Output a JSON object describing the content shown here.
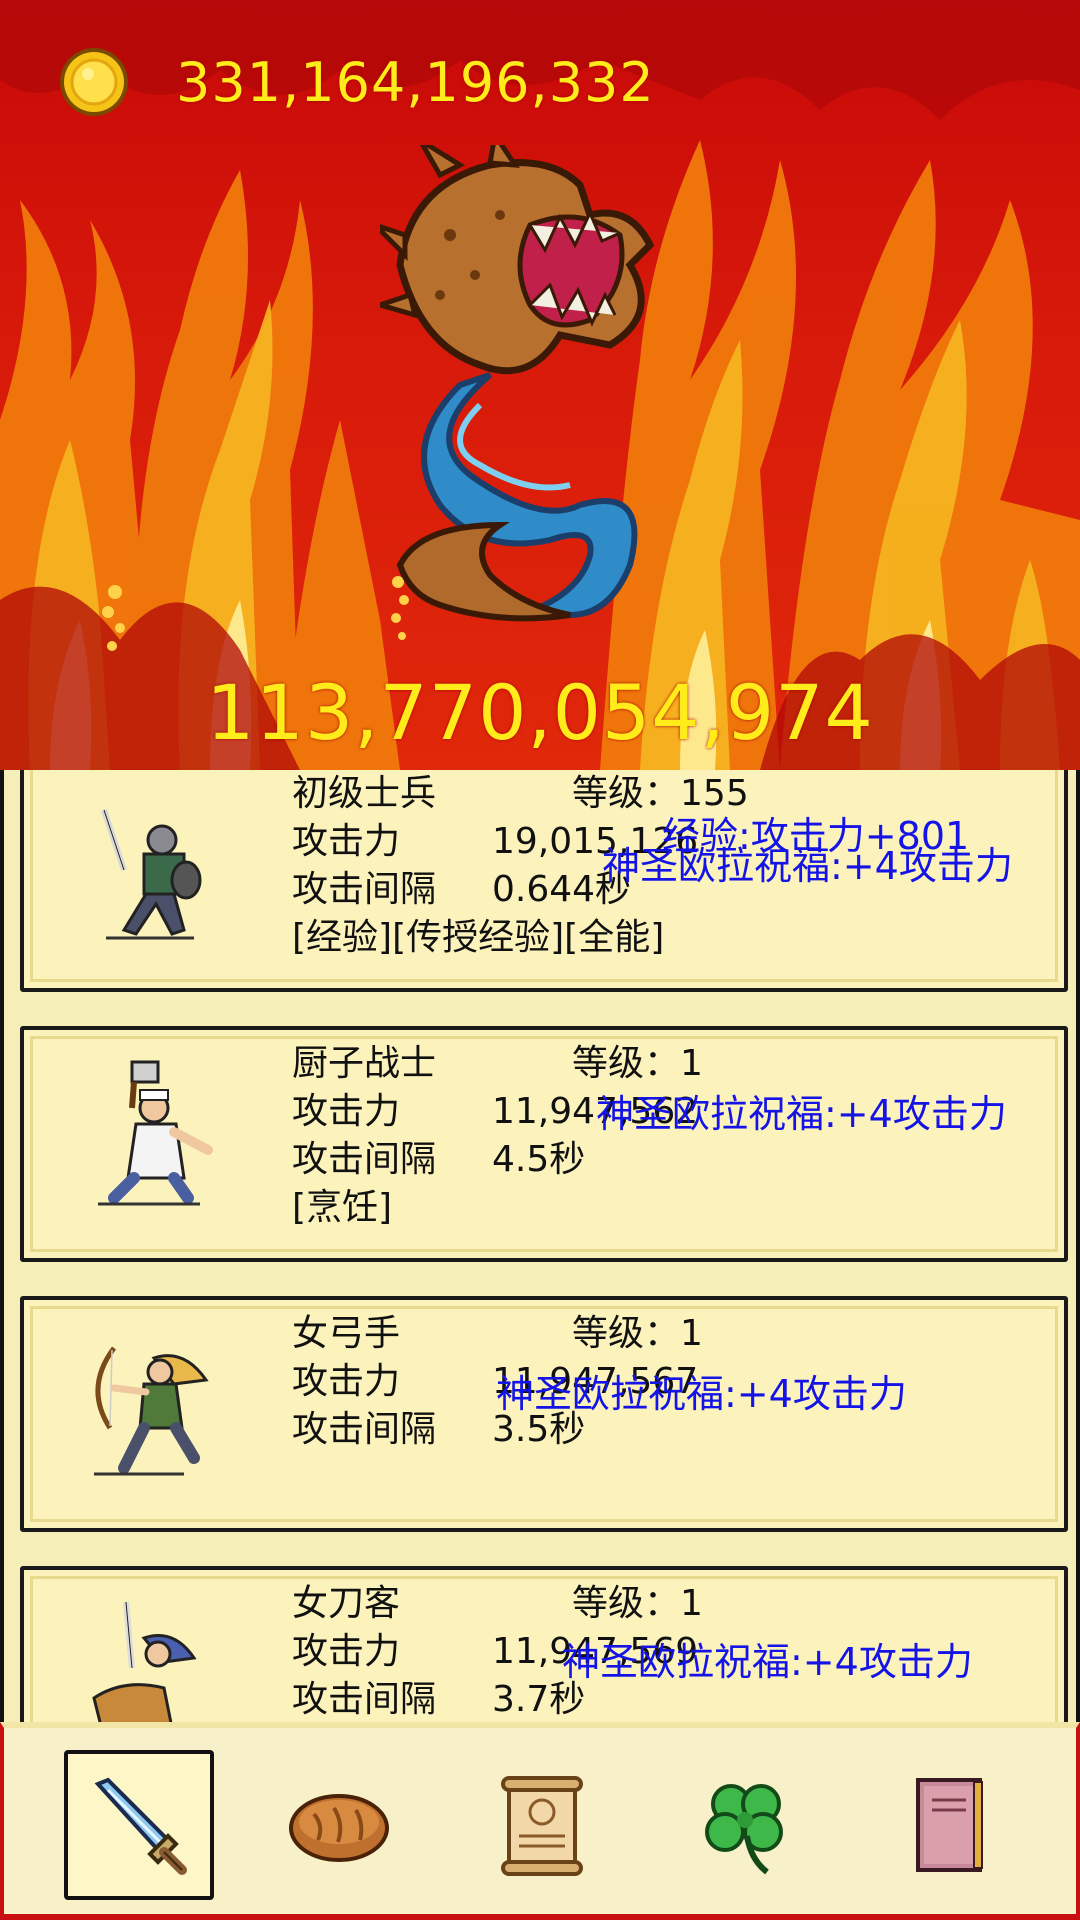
{
  "hud": {
    "gold": "331,164,196,332",
    "monster_hp": "113,770,054,974",
    "coin_icon": "gold-coin-icon",
    "monster_icon": "serpent-dragon-monster"
  },
  "labels": {
    "level": "等级：",
    "attack": "攻击力",
    "interval": "攻击间隔"
  },
  "heroes": [
    {
      "name": "初级士兵",
      "level": "155",
      "attack": "19,015,126",
      "interval": "0.644秒",
      "tags": "[经验][传授经验][全能]",
      "buffs": [
        "经验:攻击力+801",
        "神圣欧拉祝福:+4攻击力"
      ],
      "portrait": "soldier-with-sword-and-shield"
    },
    {
      "name": "厨子战士",
      "level": "1",
      "attack": "11,947,562",
      "interval": "4.5秒",
      "tags": "[烹饪]",
      "buffs": [
        "神圣欧拉祝福:+4攻击力"
      ],
      "portrait": "cook-with-cleaver"
    },
    {
      "name": "女弓手",
      "level": "1",
      "attack": "11,947,567",
      "interval": "3.5秒",
      "tags": "",
      "buffs": [
        "神圣欧拉祝福:+4攻击力"
      ],
      "portrait": "female-archer"
    },
    {
      "name": "女刀客",
      "level": "1",
      "attack": "11,947,569",
      "interval": "3.7秒",
      "tags": "",
      "buffs": [
        "神圣欧拉祝福:+4攻击力"
      ],
      "portrait": "female-swordswoman"
    }
  ],
  "nav": [
    {
      "icon": "sword-icon",
      "active": true
    },
    {
      "icon": "bread-icon",
      "active": false
    },
    {
      "icon": "scroll-icon",
      "active": false
    },
    {
      "icon": "four-leaf-clover-icon",
      "active": false
    },
    {
      "icon": "book-icon",
      "active": false
    }
  ],
  "colors": {
    "gold_text": "#ffec1a",
    "buff_text": "#1414e6",
    "card_bg": "#fbf2bc",
    "scene_red": "#c81010"
  }
}
